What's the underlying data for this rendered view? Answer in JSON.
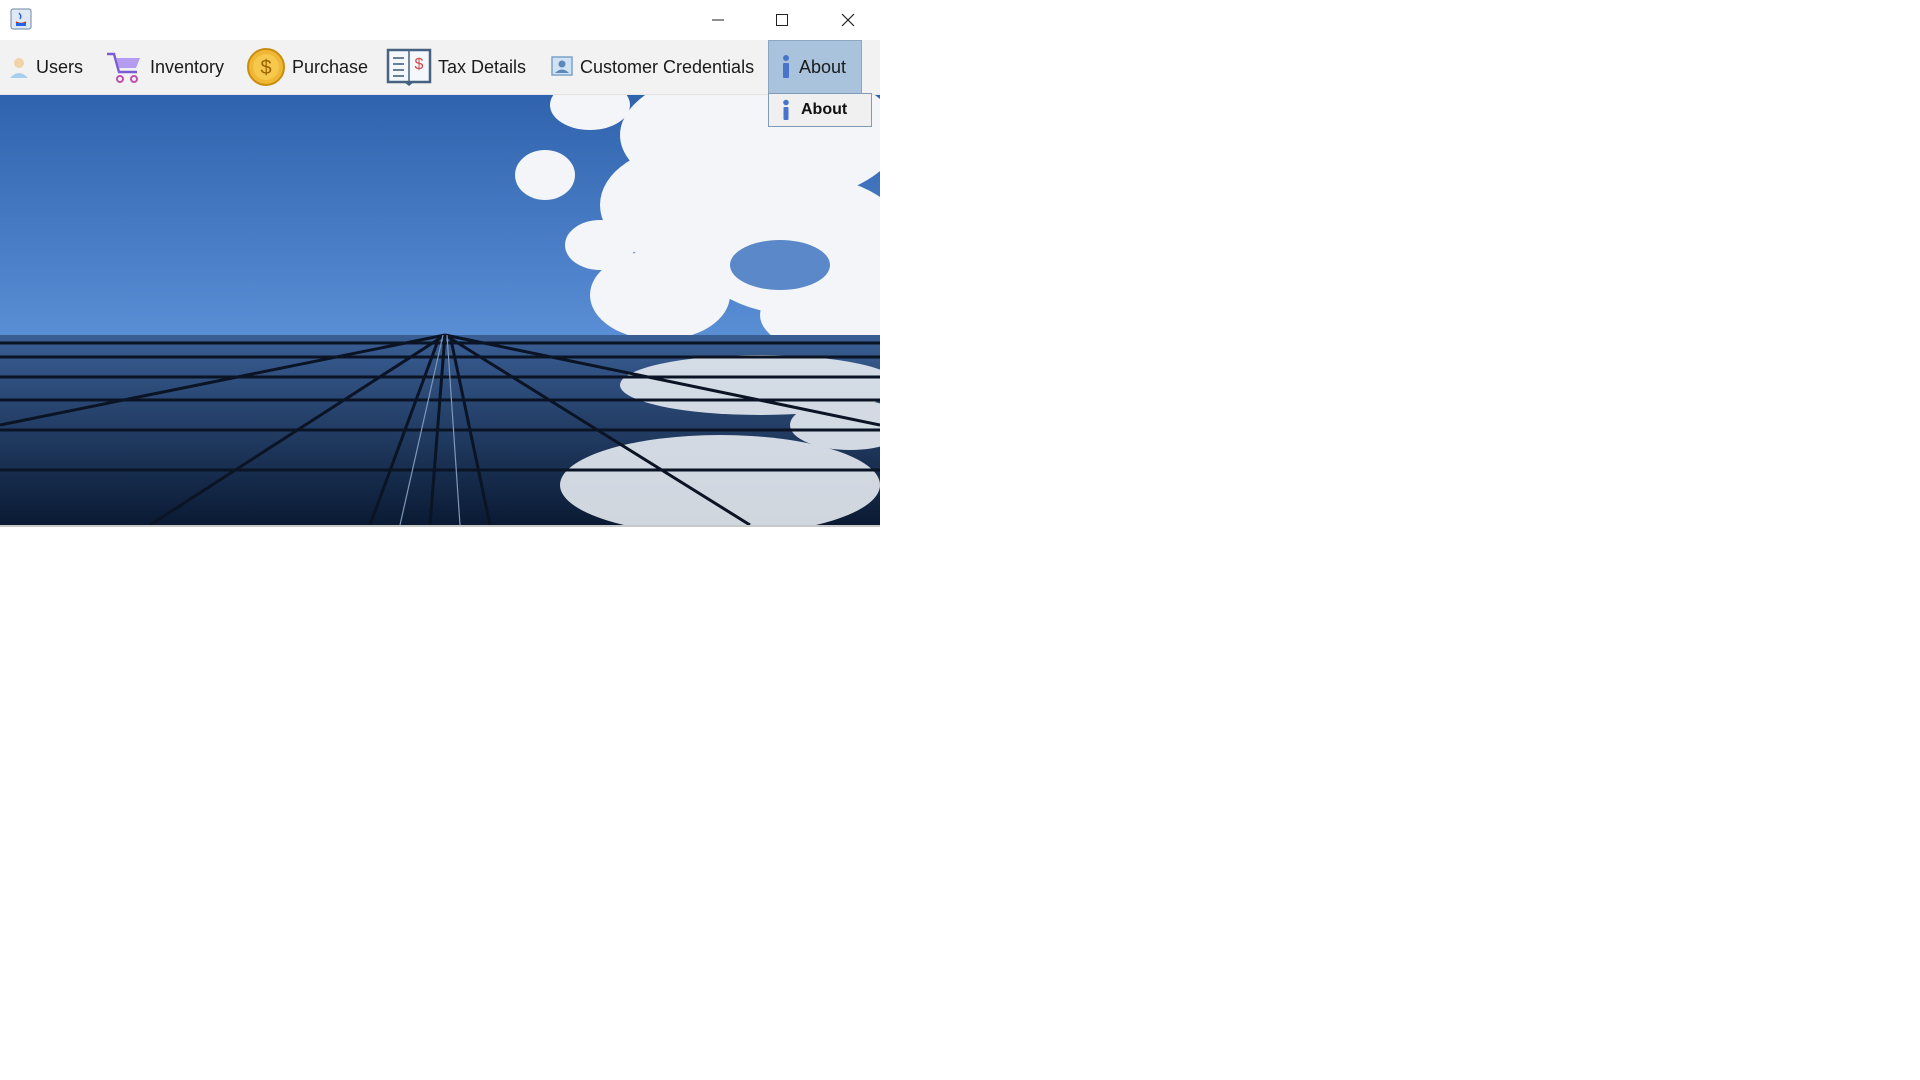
{
  "window": {
    "controls": {
      "minimize": "minimize",
      "maximize": "maximize",
      "close": "close"
    }
  },
  "menubar": {
    "items": [
      {
        "label": "Users",
        "icon": "user-icon"
      },
      {
        "label": "Inventory",
        "icon": "cart-icon"
      },
      {
        "label": "Purchase",
        "icon": "dollar-coin-icon"
      },
      {
        "label": "Tax Details",
        "icon": "tax-ledger-icon"
      },
      {
        "label": "Customer Credentials",
        "icon": "customer-card-icon"
      },
      {
        "label": "About",
        "icon": "info-icon"
      }
    ],
    "active_index": 5
  },
  "about_menu": {
    "items": [
      {
        "label": "About",
        "icon": "info-icon"
      }
    ]
  },
  "colors": {
    "menubar_bg": "#f2f2f2",
    "active_menu_bg": "#a9c3dd",
    "sky_blue": "#3f74c0",
    "building_dark": "#0d1f3b"
  }
}
